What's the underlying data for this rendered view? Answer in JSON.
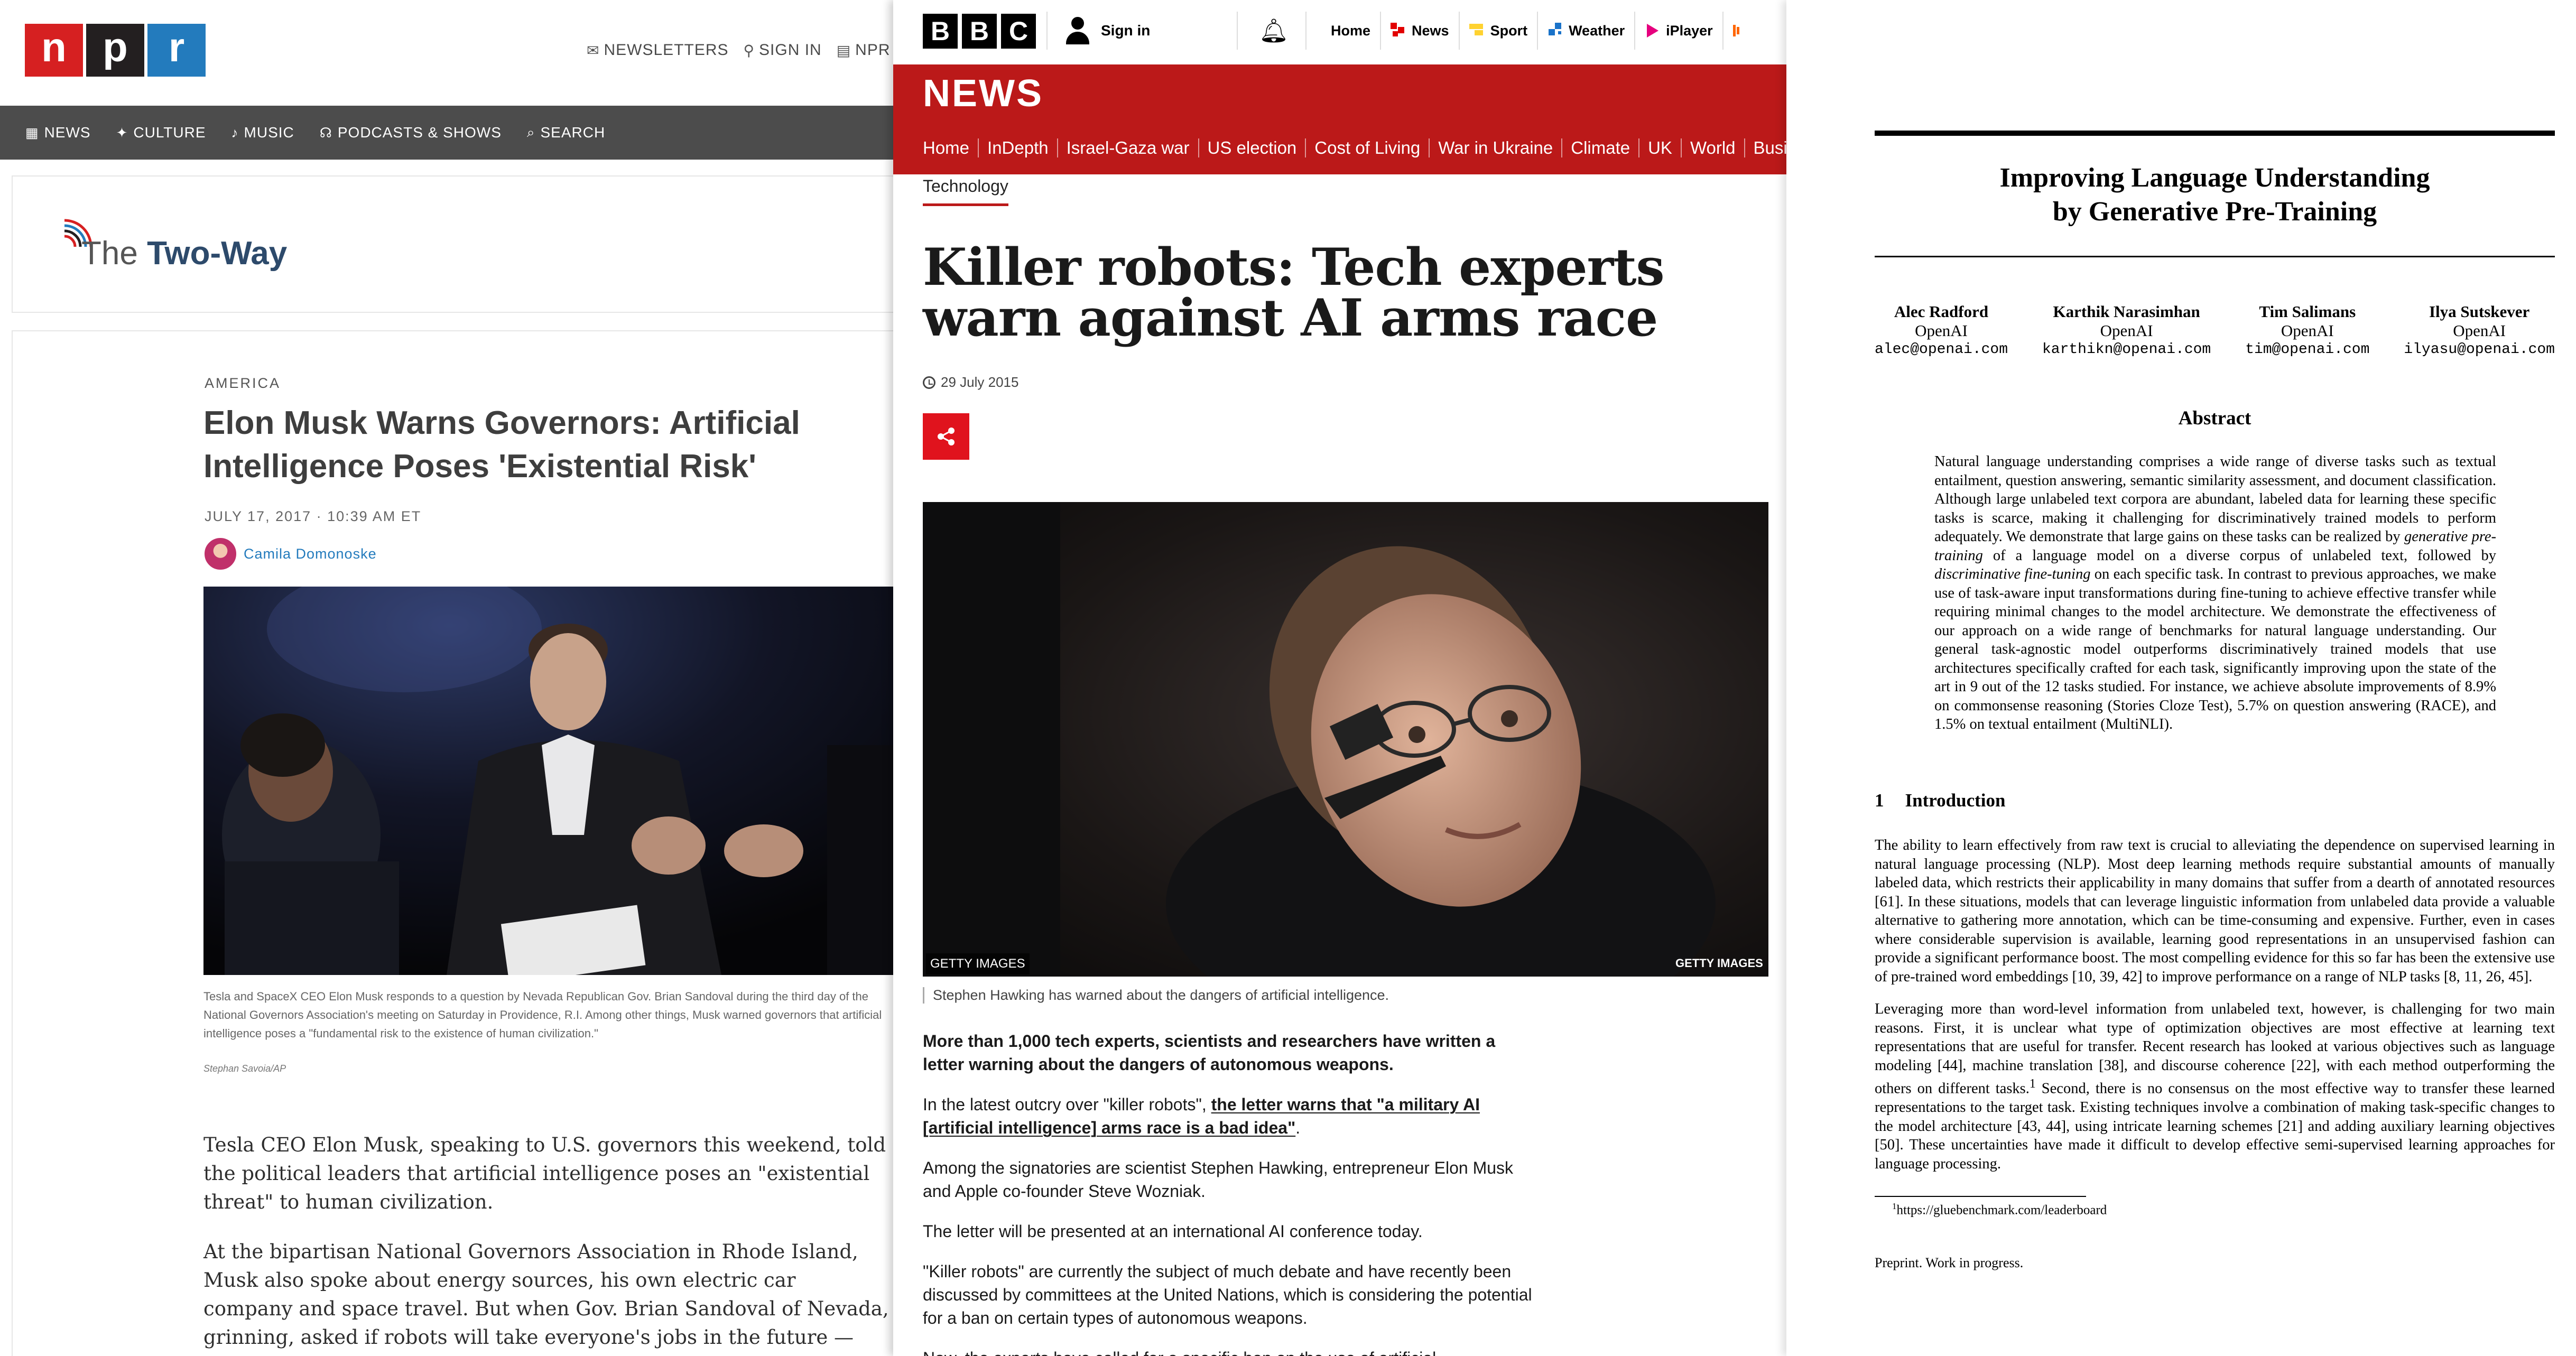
{
  "npr": {
    "logo": [
      "n",
      "p",
      "r"
    ],
    "top_links": [
      {
        "icon": "mail-icon",
        "label": "NEWSLETTERS"
      },
      {
        "icon": "user-icon",
        "label": "SIGN IN"
      },
      {
        "icon": "radio-icon",
        "label": "NPR"
      }
    ],
    "nav": [
      {
        "icon": "grid-icon",
        "label": "NEWS"
      },
      {
        "icon": "figure-icon",
        "label": "CULTURE"
      },
      {
        "icon": "music-note-icon",
        "label": "MUSIC"
      },
      {
        "icon": "headphones-icon",
        "label": "PODCASTS & SHOWS"
      },
      {
        "icon": "search-icon",
        "label": "SEARCH"
      }
    ],
    "blog_title_prefix": "The",
    "blog_title_main": "Two-Way",
    "slug": "AMERICA",
    "headline": "Elon Musk Warns Governors: Artificial Intelligence Poses 'Existential Risk'",
    "dateline": "JULY 17, 2017 · 10:39 AM ET",
    "author": "Camila Domonoske",
    "caption": "Tesla and SpaceX CEO Elon Musk responds to a question by Nevada Republican Gov. Brian Sandoval during the third day of the National Governors Association's meeting on Saturday in Providence, R.I. Among other things, Musk warned governors that artificial intelligence poses a \"fundamental risk to the existence of human civilization.\"",
    "credit": "Stephan Savoia/AP",
    "paragraphs": [
      "Tesla CEO Elon Musk, speaking to U.S. governors this weekend, told the political leaders that artificial intelligence poses an \"existential threat\" to human civilization.",
      "At the bipartisan National Governors Association in Rhode Island, Musk also spoke about energy sources, his own electric car company and space travel. But when Gov. Brian Sandoval of Nevada, grinning, asked if robots will take everyone's jobs in the future — Musk wasn't joking when he responded."
    ]
  },
  "bbc": {
    "blocks": [
      "B",
      "B",
      "C"
    ],
    "sign_in": "Sign in",
    "top_nav": [
      {
        "icon": "home-icon",
        "label": "Home",
        "color": "#000000"
      },
      {
        "icon": "news-icon",
        "label": "News",
        "color": "#e20000"
      },
      {
        "icon": "sport-icon",
        "label": "Sport",
        "color": "#ffd230"
      },
      {
        "icon": "weather-icon",
        "label": "Weather",
        "color": "#1a73c9"
      },
      {
        "icon": "iplayer-icon",
        "label": "iPlayer",
        "color": "#e6007e"
      }
    ],
    "news_title": "NEWS",
    "sections": [
      "Home",
      "InDepth",
      "Israel-Gaza war",
      "US election",
      "Cost of Living",
      "War in Ukraine",
      "Climate",
      "UK",
      "World",
      "Busin"
    ],
    "subsection": "Technology",
    "headline": "Killer robots: Tech experts warn against AI arms race",
    "date": "29 July 2015",
    "getty_left": "GETTY IMAGES",
    "getty_right": "GETTY IMAGES",
    "caption": "Stephen Hawking has warned about the dangers of artificial intelligence.",
    "lead": "More than 1,000 tech experts, scientists and researchers have written a letter warning about the dangers of autonomous weapons.",
    "p2_before": "In the latest outcry over \"killer robots\", ",
    "p2_link": "the letter warns that \"a military AI [artificial intelligence] arms race is a bad idea\"",
    "p2_after": ".",
    "p3": "Among the signatories are scientist Stephen Hawking, entrepreneur Elon Musk and Apple co-founder Steve Wozniak.",
    "p4": "The letter will be presented at an international AI conference today.",
    "p5": "\"Killer robots\" are currently the subject of much debate and have recently been discussed by committees at the United Nations, which is considering the potential for a ban on certain types of autonomous weapons.",
    "p6": "Now, the experts have called for a specific ban on the use of artificial",
    "accent": "#bb1919"
  },
  "paper": {
    "title_line1": "Improving Language Understanding",
    "title_line2": "by Generative Pre-Training",
    "authors": [
      {
        "name": "Alec Radford",
        "affil": "OpenAI",
        "email": "alec@openai.com"
      },
      {
        "name": "Karthik Narasimhan",
        "affil": "OpenAI",
        "email": "karthikn@openai.com"
      },
      {
        "name": "Tim Salimans",
        "affil": "OpenAI",
        "email": "tim@openai.com"
      },
      {
        "name": "Ilya Sutskever",
        "affil": "OpenAI",
        "email": "ilyasu@openai.com"
      }
    ],
    "abstract_heading": "Abstract",
    "abstract_1": "Natural language understanding comprises a wide range of diverse tasks such as textual entailment, question answering, semantic similarity assessment, and document classification. Although large unlabeled text corpora are abundant, labeled data for learning these specific tasks is scarce, making it challenging for discriminatively trained models to perform adequately. We demonstrate that large gains on these tasks can be realized by ",
    "abstract_em1": "generative pre-training",
    "abstract_2": " of a language model on a diverse corpus of unlabeled text, followed by ",
    "abstract_em2": "discriminative fine-tuning",
    "abstract_3": " on each specific task. In contrast to previous approaches, we make use of task-aware input transformations during fine-tuning to achieve effective transfer while requiring minimal changes to the model architecture. We demonstrate the effectiveness of our approach on a wide range of benchmarks for natural language understanding. Our general task-agnostic model outperforms discriminatively trained models that use architectures specifically crafted for each task, significantly improving upon the state of the art in 9 out of the 12 tasks studied. For instance, we achieve absolute improvements of 8.9% on commonsense reasoning (Stories Cloze Test), 5.7% on question answering (RACE), and 1.5% on textual entailment (MultiNLI).",
    "intro_number": "1",
    "intro_heading": "Introduction",
    "intro_p1": "The ability to learn effectively from raw text is crucial to alleviating the dependence on supervised learning in natural language processing (NLP). Most deep learning methods require substantial amounts of manually labeled data, which restricts their applicability in many domains that suffer from a dearth of annotated resources [61]. In these situations, models that can leverage linguistic information from unlabeled data provide a valuable alternative to gathering more annotation, which can be time-consuming and expensive. Further, even in cases where considerable supervision is available, learning good representations in an unsupervised fashion can provide a significant performance boost. The most compelling evidence for this so far has been the extensive use of pre-trained word embeddings [10, 39, 42] to improve performance on a range of NLP tasks [8, 11, 26, 45].",
    "intro_p2a": "Leveraging more than word-level information from unlabeled text, however, is challenging for two main reasons. First, it is unclear what type of optimization objectives are most effective at learning text representations that are useful for transfer. Recent research has looked at various objectives such as language modeling [44], machine translation [38], and discourse coherence [22], with each method outperforming the others on different tasks.",
    "intro_p2_sup": "1",
    "intro_p2b": " Second, there is no consensus on the most effective way to transfer these learned representations to the target task. Existing techniques involve a combination of making task-specific changes to the model architecture [43, 44], using intricate learning schemes [21] and adding auxiliary learning objectives [50]. These uncertainties have made it difficult to develop effective semi-supervised learning approaches for language processing.",
    "footnote_mark": "1",
    "footnote": "https://gluebenchmark.com/leaderboard",
    "preprint": "Preprint. Work in progress."
  }
}
